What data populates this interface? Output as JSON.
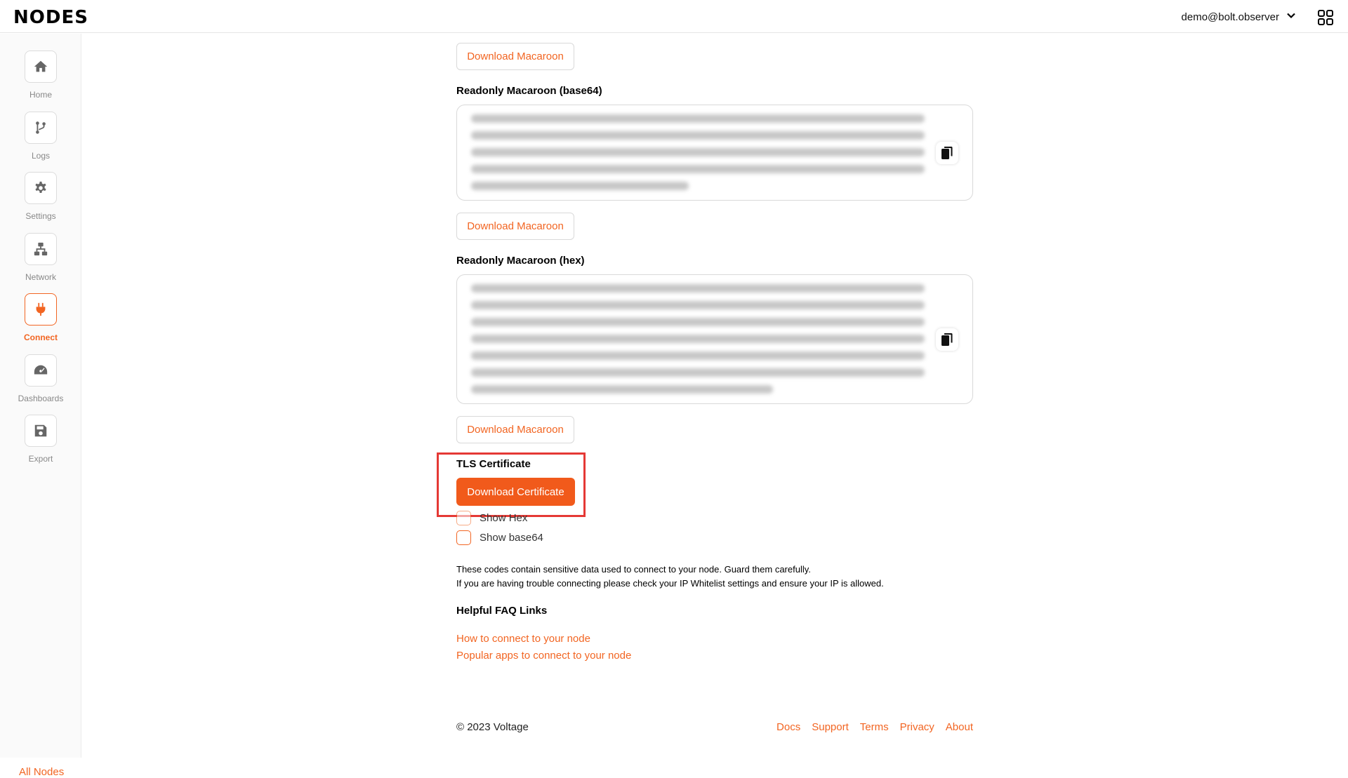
{
  "header": {
    "logo": "NODES",
    "user_email": "demo@bolt.observer"
  },
  "sidebar": {
    "items": [
      {
        "label": "Home",
        "icon": "home-icon"
      },
      {
        "label": "Logs",
        "icon": "branch-icon"
      },
      {
        "label": "Settings",
        "icon": "gear-icon"
      },
      {
        "label": "Network",
        "icon": "network-icon"
      },
      {
        "label": "Connect",
        "icon": "plug-icon",
        "active": true
      },
      {
        "label": "Dashboards",
        "icon": "gauge-icon"
      },
      {
        "label": "Export",
        "icon": "save-icon"
      }
    ],
    "all_nodes": "All Nodes"
  },
  "main": {
    "download_macaroon_label": "Download Macaroon",
    "readonly_base64_label": "Readonly Macaroon (base64)",
    "readonly_hex_label": "Readonly Macaroon (hex)",
    "tls_label": "TLS Certificate",
    "download_certificate_label": "Download Certificate",
    "show_hex_label": "Show Hex",
    "show_base64_label": "Show base64",
    "info_line_1": "These codes contain sensitive data used to connect to your node. Guard them carefully.",
    "info_line_2": "If you are having trouble connecting please check your IP Whitelist settings and ensure your IP is allowed.",
    "faq_title": "Helpful FAQ Links",
    "faq_links": [
      "How to connect to your node",
      "Popular apps to connect to your node"
    ]
  },
  "footer": {
    "copyright": "© 2023 Voltage",
    "links": [
      "Docs",
      "Support",
      "Terms",
      "Privacy",
      "About"
    ]
  },
  "colors": {
    "accent": "#f26522",
    "primary_button": "#f15a1b",
    "highlight_frame": "#e53935"
  }
}
